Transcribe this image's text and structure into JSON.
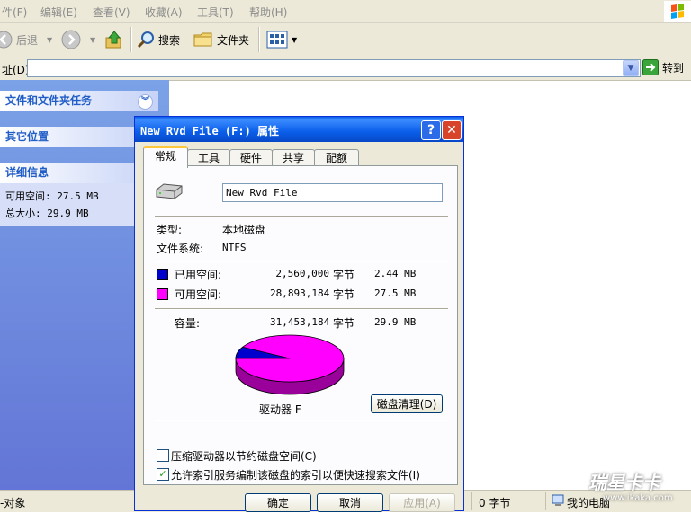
{
  "menubar": {
    "items": [
      "件(F)",
      "编辑(E)",
      "查看(V)",
      "收藏(A)",
      "工具(T)",
      "帮助(H)"
    ]
  },
  "toolbar": {
    "back_label": "后退",
    "search_label": "搜索",
    "folders_label": "文件夹"
  },
  "addressbar": {
    "label": "址(D)",
    "value": "",
    "go_label": "转到"
  },
  "taskpane": {
    "file_tasks_title": "文件和文件夹任务",
    "other_places_title": "其它位置",
    "details_title": "详细信息",
    "free_space": "可用空间: 27.5 MB",
    "total_size": "总大小: 29.9 MB"
  },
  "statusbar": {
    "objects": "-对象",
    "bytes": "0 字节",
    "my_computer": "我的电脑"
  },
  "dialog": {
    "title": "New Rvd File (F:) 属性",
    "help_button": "?",
    "close_button": "✕",
    "tabs": [
      "常规",
      "工具",
      "硬件",
      "共享",
      "配额"
    ],
    "active_tab": "常规",
    "volume_name": "New Rvd File",
    "type_label": "类型:",
    "type_value": "本地磁盘",
    "fs_label": "文件系统:",
    "fs_value": "NTFS",
    "used": {
      "label": "已用空间:",
      "bytes": "2,560,000",
      "unit": "字节",
      "size": "2.44 MB",
      "color": "#0000cc"
    },
    "free": {
      "label": "可用空间:",
      "bytes": "28,893,184",
      "unit": "字节",
      "size": "27.5 MB",
      "color": "#ff00ff"
    },
    "capacity": {
      "label": "容量:",
      "bytes": "31,453,184",
      "unit": "字节",
      "size": "29.9 MB"
    },
    "used_fraction": 0.0814,
    "drive_label": "驱动器 F",
    "cleanup_button": "磁盘清理(D)",
    "compress_label": "压缩驱动器以节约磁盘空间(C)",
    "compress_checked": false,
    "index_label": "允许索引服务编制该磁盘的索引以便快速搜索文件(I)",
    "index_checked": true,
    "ok_button": "确定",
    "cancel_button": "取消",
    "apply_button": "应用(A)"
  },
  "watermark": {
    "text": "瑞星卡卡",
    "url": "www.ikaka.com"
  }
}
